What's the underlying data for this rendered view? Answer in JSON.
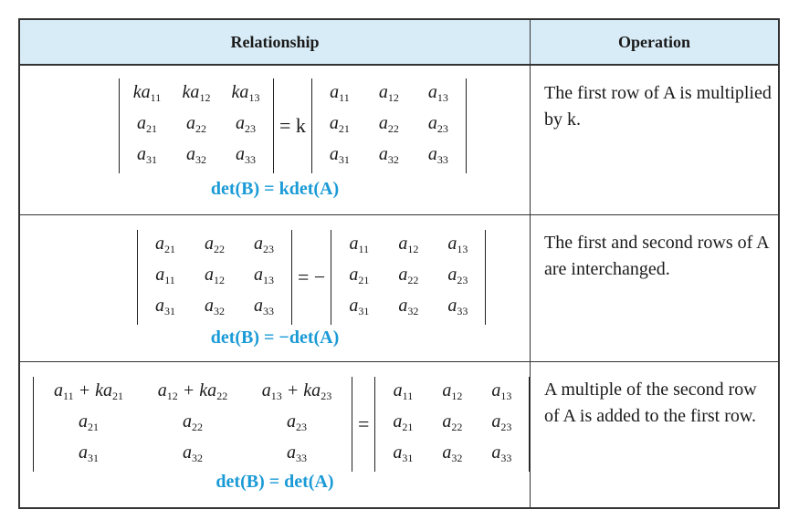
{
  "header": {
    "relationship": "Relationship",
    "operation": "Operation"
  },
  "rows": [
    {
      "left_matrix": [
        [
          "ka11",
          "ka12",
          "ka13"
        ],
        [
          "a21",
          "a22",
          "a23"
        ],
        [
          "a31",
          "a32",
          "a33"
        ]
      ],
      "operator": "= k",
      "right_matrix": [
        [
          "a11",
          "a12",
          "a13"
        ],
        [
          "a21",
          "a22",
          "a23"
        ],
        [
          "a31",
          "a32",
          "a33"
        ]
      ],
      "formula": "det(B) = kdet(A)",
      "operation": "The first row of A is multiplied by k."
    },
    {
      "left_matrix": [
        [
          "a21",
          "a22",
          "a23"
        ],
        [
          "a11",
          "a12",
          "a13"
        ],
        [
          "a31",
          "a32",
          "a33"
        ]
      ],
      "operator": "= −",
      "right_matrix": [
        [
          "a11",
          "a12",
          "a13"
        ],
        [
          "a21",
          "a22",
          "a23"
        ],
        [
          "a31",
          "a32",
          "a33"
        ]
      ],
      "formula": "det(B) = −det(A)",
      "operation": "The first and second rows of A are interchanged."
    },
    {
      "left_matrix": [
        [
          "a11 + ka21",
          "a12 + ka22",
          "a13 + ka23"
        ],
        [
          "a21",
          "a22",
          "a23"
        ],
        [
          "a31",
          "a32",
          "a33"
        ]
      ],
      "operator": "=",
      "right_matrix": [
        [
          "a11",
          "a12",
          "a13"
        ],
        [
          "a21",
          "a22",
          "a23"
        ],
        [
          "a31",
          "a32",
          "a33"
        ]
      ],
      "formula": "det(B) = det(A)",
      "operation": "A multiple of the second row of A is added to the first row."
    }
  ]
}
